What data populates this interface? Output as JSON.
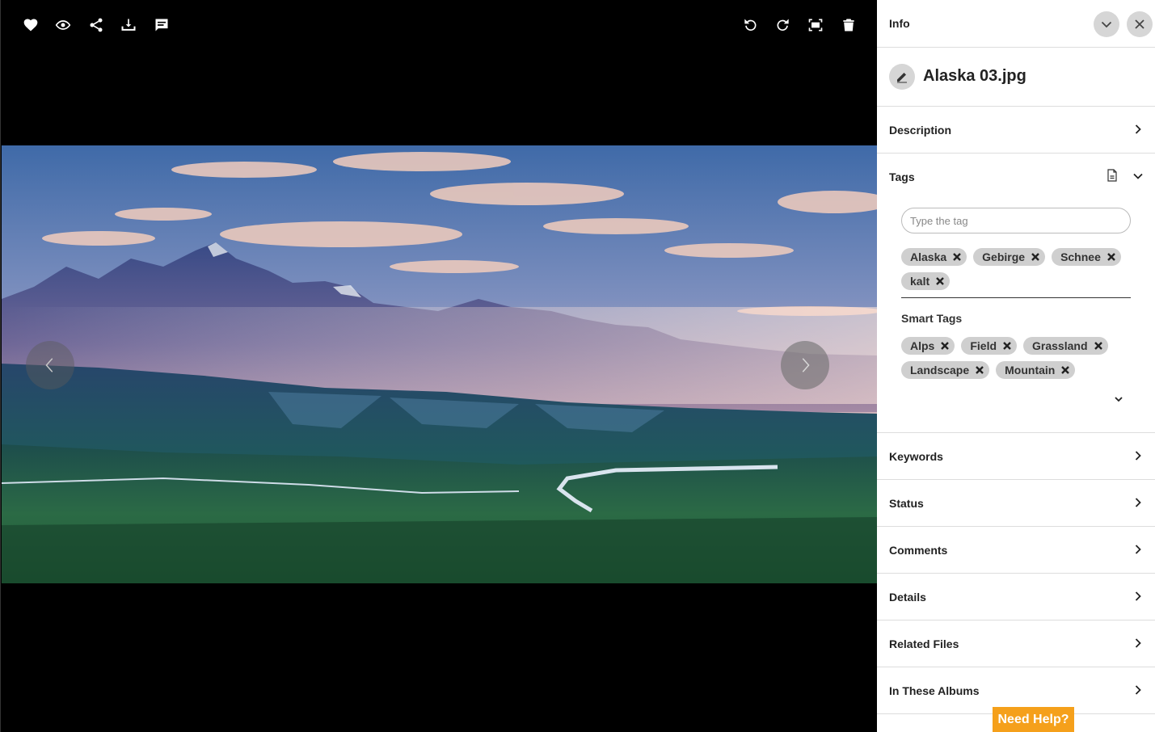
{
  "toolbar": {
    "left_icons": [
      "heart-icon",
      "eye-icon",
      "share-icon",
      "download-icon",
      "comment-icon"
    ],
    "right_icons": [
      "rotate-left-icon",
      "rotate-right-icon",
      "fit-screen-icon",
      "trash-icon"
    ]
  },
  "panel": {
    "title": "Info",
    "file_name": "Alaska 03.jpg",
    "tags_label": "Tags",
    "tag_input_placeholder": "Type the tag",
    "tags": [
      "Alaska",
      "Gebirge",
      "Schnee",
      "kalt"
    ],
    "smart_tags_label": "Smart Tags",
    "smart_tags": [
      "Alps",
      "Field",
      "Grassland",
      "Landscape",
      "Mountain"
    ],
    "sections_above": [
      "Description"
    ],
    "sections_below": [
      "Keywords",
      "Status",
      "Comments",
      "Details",
      "Related Files",
      "In These Albums"
    ]
  },
  "help_button": "Need Help?",
  "colors": {
    "help": "#f5a01b",
    "chip": "#cfcfcf",
    "panel_bg": "#ffffff",
    "viewer_bg": "#000000"
  }
}
